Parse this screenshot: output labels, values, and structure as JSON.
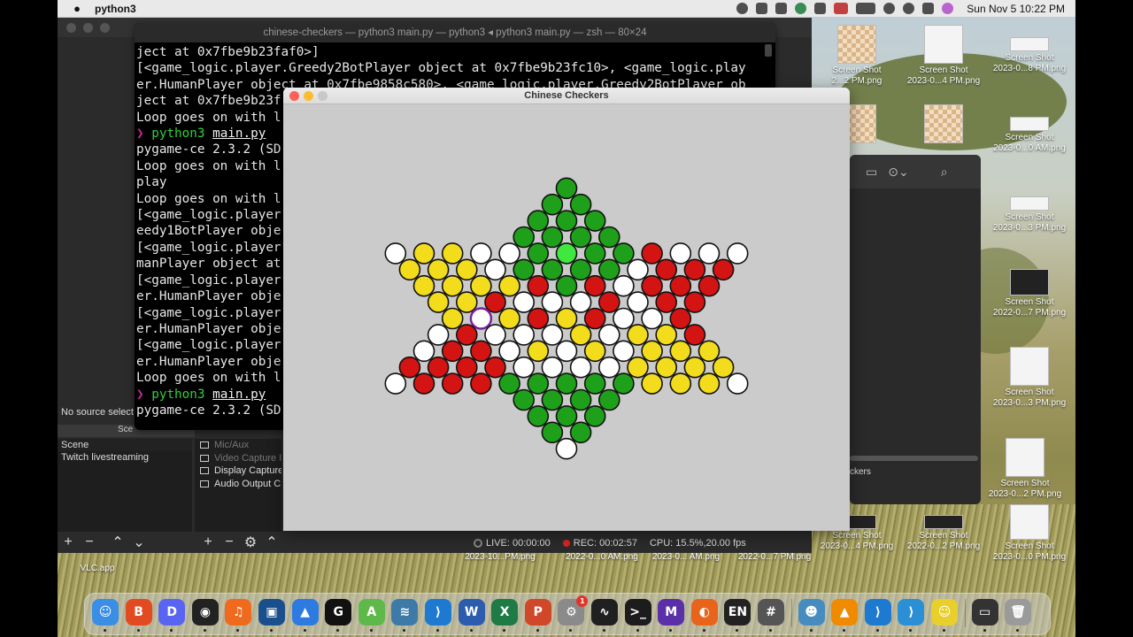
{
  "menubar": {
    "app_name": "python3",
    "clock": "Sun Nov 5  10:22 PM",
    "status_icons": [
      "obs-icon",
      "sound-bars-icon",
      "vlc-icon",
      "paypal-icon",
      "bluetooth-icon",
      "flag-us-icon",
      "battery-icon",
      "wifi-icon",
      "search-icon",
      "control-center-icon",
      "siri-icon"
    ]
  },
  "terminal": {
    "title": "chinese-checkers — python3 main.py — python3 ◂ python3 main.py — zsh — 80×24",
    "lines": [
      "ject at 0x7fbe9b23faf0>]",
      "[<game_logic.player.Greedy2BotPlayer object at 0x7fbe9b23fc10>, <game_logic.play",
      "er.HumanPlayer object at 0x7fbe9858c580>, <game_logic.player.Greedy2BotPlayer ob",
      "ject at 0x7fbe9b23f",
      "Loop goes on with l",
      "",
      "pygame-ce 2.3.2 (SD",
      "Loop goes on with l",
      "play",
      "Loop goes on with l",
      "[<game_logic.player",
      "eedy1BotPlayer obje",
      "[<game_logic.player",
      "manPlayer object at",
      "[<game_logic.player",
      "er.HumanPlayer obje",
      "[<game_logic.player",
      "er.HumanPlayer obje",
      "[<game_logic.player",
      "er.HumanPlayer obje",
      "Loop goes on with l",
      "",
      "pygame-ce 2.3.2 (SD"
    ],
    "prompt_symbol": "❯",
    "cmd_word": "python3",
    "cmd_file": "main.py"
  },
  "obs": {
    "no_source": "No source select",
    "scenes_header": "Sce",
    "scenes": [
      "Scene",
      "Twitch livestreaming"
    ],
    "sources": [
      "Mic/Aux",
      "Video Capture I",
      "Display Capture",
      "Audio Output C"
    ],
    "live": "LIVE: 00:00:00",
    "rec": "REC: 00:02:57",
    "cpu": "CPU: 15.5%,20.00 fps"
  },
  "finder": {
    "sidebar_label": "ckers"
  },
  "game": {
    "title": "Chinese Checkers",
    "colors": {
      "green": "#1fa01a",
      "yellow": "#f2dc1c",
      "red": "#d41313",
      "empty": "#ffffff",
      "highlight": "#3ee83e",
      "target_ring": "#7a1e9c",
      "background": "#cbcbcb"
    },
    "counts": {
      "green": 21,
      "yellow": 20,
      "red": 21
    }
  },
  "desktop": {
    "icons": [
      {
        "label1": "Screen Shot",
        "label2": "2...2 PM.png"
      },
      {
        "label1": "Screen Shot",
        "label2": "2023-0...4 PM.png"
      },
      {
        "label1": "Screen Shot",
        "label2": "2023-0...8 PM.png"
      },
      {
        "label1": "Screen Shot",
        "label2": "2023-0...0 AM.png"
      },
      {
        "label1": "Screen Shot",
        "label2": "2023-0...3 PM.png"
      },
      {
        "label1": "Screen Shot",
        "label2": "2022-0...7 PM.png"
      },
      {
        "label1": "Screen Shot",
        "label2": "2023-0...3 PM.png"
      },
      {
        "label1": "Screen Shot",
        "label2": "2023-0...2 PM.png"
      },
      {
        "label1": "Screen Shot",
        "label2": "2023-0...4 PM.png"
      },
      {
        "label1": "Screen Shot",
        "label2": "2022-0...2 PM.png"
      },
      {
        "label1": "Screen Shot",
        "label2": "2023-0...0 PM.png"
      }
    ],
    "bottom_row": [
      "2023-10...PM.png",
      "2022-0...0 AM.png",
      "2023-0... AM.png",
      "2022-0...7 PM.png"
    ],
    "vlc_label": "VLC.app"
  },
  "dock": {
    "items": [
      {
        "name": "finder-icon",
        "glyph": "☺",
        "color": "#3a8ee6"
      },
      {
        "name": "brave-icon",
        "glyph": "B",
        "color": "#e24a22"
      },
      {
        "name": "discord-icon",
        "glyph": "D",
        "color": "#5865f2"
      },
      {
        "name": "obs-icon",
        "glyph": "◉",
        "color": "#222222"
      },
      {
        "name": "audacity-icon",
        "glyph": "♫",
        "color": "#f06a1d"
      },
      {
        "name": "virtualbox-icon",
        "glyph": "▣",
        "color": "#1a4f8e"
      },
      {
        "name": "altserver-icon",
        "glyph": "▲",
        "color": "#2d7be0"
      },
      {
        "name": "logitech-g-icon",
        "glyph": "G",
        "color": "#111111"
      },
      {
        "name": "android-icon",
        "glyph": "A",
        "color": "#5fb94a"
      },
      {
        "name": "mysql-workbench-icon",
        "glyph": "≋",
        "color": "#3d7aa8"
      },
      {
        "name": "vscode-icon",
        "glyph": "⟩",
        "color": "#1e7ad0"
      },
      {
        "name": "word-icon",
        "glyph": "W",
        "color": "#2b5cae"
      },
      {
        "name": "excel-icon",
        "glyph": "X",
        "color": "#1e7b45"
      },
      {
        "name": "powerpoint-icon",
        "glyph": "P",
        "color": "#d0472a"
      },
      {
        "name": "system-settings-icon",
        "glyph": "⚙",
        "color": "#8a8a8a",
        "badge": "1"
      },
      {
        "name": "activity-monitor-icon",
        "glyph": "∿",
        "color": "#202020"
      },
      {
        "name": "terminal-icon",
        "glyph": ">_",
        "color": "#1c1c1c"
      },
      {
        "name": "muse-icon",
        "glyph": "M",
        "color": "#5a2fa8"
      },
      {
        "name": "firefox-icon",
        "glyph": "◐",
        "color": "#e8641b"
      },
      {
        "name": "language-icon",
        "glyph": "EN",
        "color": "#222222"
      },
      {
        "name": "calculator-icon",
        "glyph": "#",
        "color": "#555555"
      },
      {
        "name": "godot-icon",
        "glyph": "☻",
        "color": "#478cbf"
      },
      {
        "name": "vlc-icon",
        "glyph": "▲",
        "color": "#f08a00"
      },
      {
        "name": "vscode-alt-icon",
        "glyph": "⟩",
        "color": "#1e7ad0"
      },
      {
        "name": "vscode-insiders-icon",
        "glyph": "⟩",
        "color": "#2b8fd6"
      },
      {
        "name": "python-icon",
        "glyph": "☺",
        "color": "#e9cf2c"
      },
      {
        "name": "screenshot-folder-icon",
        "glyph": "▭",
        "color": "#333333"
      },
      {
        "name": "trash-icon",
        "glyph": "🗑",
        "color": "#9a9a9a"
      }
    ]
  }
}
